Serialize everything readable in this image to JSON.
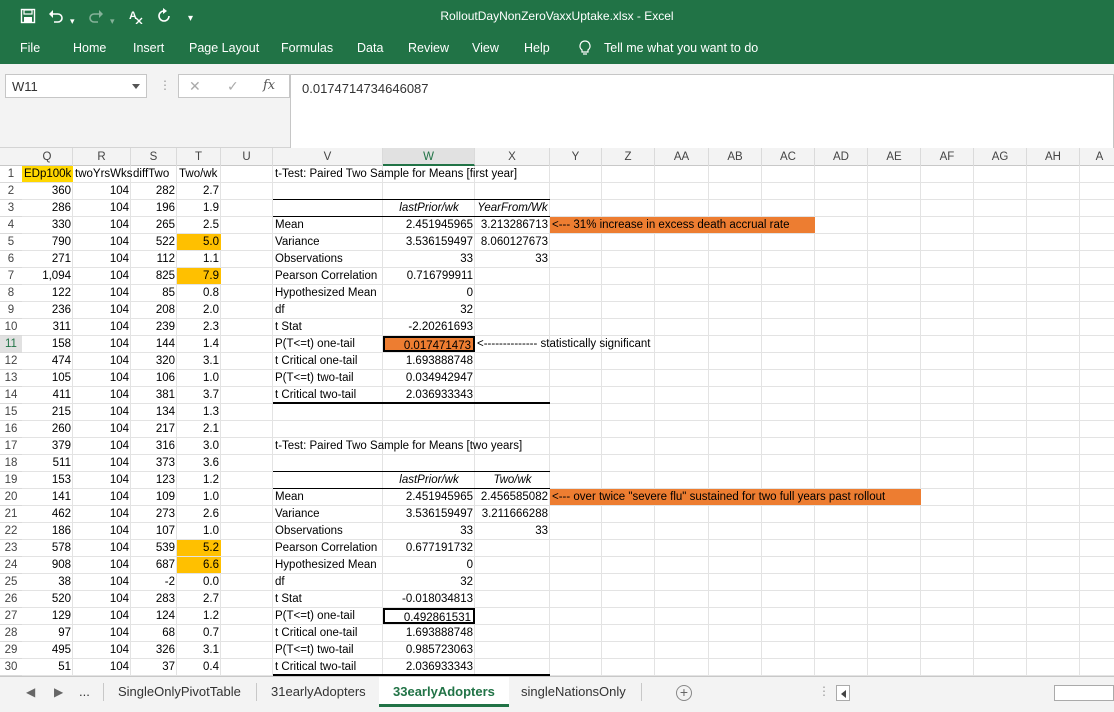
{
  "window": {
    "title": "RolloutDayNonZeroVaxxUptake.xlsx  -  Excel"
  },
  "ribbon": {
    "tabs": [
      "File",
      "Home",
      "Insert",
      "Page Layout",
      "Formulas",
      "Data",
      "Review",
      "View",
      "Help"
    ],
    "tell_me": "Tell me what you want to do"
  },
  "formula_bar": {
    "name_box": "W11",
    "cancel": "✕",
    "enter": "✓",
    "fx": "fx",
    "value": "0.0174714734646087"
  },
  "columns": [
    "Q",
    "R",
    "S",
    "T",
    "U",
    "V",
    "W",
    "X",
    "Y",
    "Z",
    "AA",
    "AB",
    "AC",
    "AD",
    "AE",
    "AF",
    "AG",
    "AH",
    "A"
  ],
  "rows": [
    "1",
    "2",
    "3",
    "4",
    "5",
    "6",
    "7",
    "8",
    "9",
    "10",
    "11",
    "12",
    "13",
    "14",
    "15",
    "16",
    "17",
    "18",
    "19",
    "20",
    "21",
    "22",
    "23",
    "24",
    "25",
    "26",
    "27",
    "28",
    "29",
    "30"
  ],
  "headers": {
    "q": "EDp100k",
    "r": "twoYrsWks",
    "s": "diffTwo",
    "t": "Two/wk"
  },
  "data_rows": [
    [
      "360",
      "104",
      "282",
      "2.7"
    ],
    [
      "286",
      "104",
      "196",
      "1.9"
    ],
    [
      "330",
      "104",
      "265",
      "2.5"
    ],
    [
      "790",
      "104",
      "522",
      "5.0"
    ],
    [
      "271",
      "104",
      "112",
      "1.1"
    ],
    [
      "1,094",
      "104",
      "825",
      "7.9"
    ],
    [
      "122",
      "104",
      "85",
      "0.8"
    ],
    [
      "236",
      "104",
      "208",
      "2.0"
    ],
    [
      "311",
      "104",
      "239",
      "2.3"
    ],
    [
      "158",
      "104",
      "144",
      "1.4"
    ],
    [
      "474",
      "104",
      "320",
      "3.1"
    ],
    [
      "105",
      "104",
      "106",
      "1.0"
    ],
    [
      "411",
      "104",
      "381",
      "3.7"
    ],
    [
      "215",
      "104",
      "134",
      "1.3"
    ],
    [
      "260",
      "104",
      "217",
      "2.1"
    ],
    [
      "379",
      "104",
      "316",
      "3.0"
    ],
    [
      "511",
      "104",
      "373",
      "3.6"
    ],
    [
      "153",
      "104",
      "123",
      "1.2"
    ],
    [
      "141",
      "104",
      "109",
      "1.0"
    ],
    [
      "462",
      "104",
      "273",
      "2.6"
    ],
    [
      "186",
      "104",
      "107",
      "1.0"
    ],
    [
      "578",
      "104",
      "539",
      "5.2"
    ],
    [
      "908",
      "104",
      "687",
      "6.6"
    ],
    [
      "38",
      "104",
      "-2",
      "0.0"
    ],
    [
      "520",
      "104",
      "283",
      "2.7"
    ],
    [
      "129",
      "104",
      "124",
      "1.2"
    ],
    [
      "97",
      "104",
      "68",
      "0.7"
    ],
    [
      "495",
      "104",
      "326",
      "3.1"
    ],
    [
      "51",
      "104",
      "37",
      "0.4"
    ]
  ],
  "ttest1": {
    "title": "t-Test: Paired Two Sample for Means [first year]",
    "col_a": "lastPrior/wk",
    "col_b": "YearFrom/Wk",
    "rows": [
      [
        "Mean",
        "2.451945965",
        "3.213286713"
      ],
      [
        "Variance",
        "3.536159497",
        "8.060127673"
      ],
      [
        "Observations",
        "33",
        "33"
      ],
      [
        "Pearson Correlation",
        "0.716799911",
        ""
      ],
      [
        "Hypothesized Mean",
        "0",
        ""
      ],
      [
        "df",
        "32",
        ""
      ],
      [
        "t Stat",
        "-2.20261693",
        ""
      ],
      [
        "P(T<=t) one-tail",
        "0.017471473",
        ""
      ],
      [
        "t Critical one-tail",
        "1.693888748",
        ""
      ],
      [
        "P(T<=t) two-tail",
        "0.034942947",
        ""
      ],
      [
        "t Critical two-tail",
        "2.036933343",
        ""
      ]
    ],
    "note_mean": "<--- 31% increase in excess death accrual rate",
    "note_p": "<-------------- statistically significant"
  },
  "ttest2": {
    "title": "t-Test: Paired Two Sample for Means [two years]",
    "col_a": "lastPrior/wk",
    "col_b": "Two/wk",
    "rows": [
      [
        "Mean",
        "2.451945965",
        "2.456585082"
      ],
      [
        "Variance",
        "3.536159497",
        "3.211666288"
      ],
      [
        "Observations",
        "33",
        "33"
      ],
      [
        "Pearson Correlation",
        "0.677191732",
        ""
      ],
      [
        "Hypothesized Mean",
        "0",
        ""
      ],
      [
        "df",
        "32",
        ""
      ],
      [
        "t Stat",
        "-0.018034813",
        ""
      ],
      [
        "P(T<=t) one-tail",
        "0.492861531",
        ""
      ],
      [
        "t Critical one-tail",
        "1.693888748",
        ""
      ],
      [
        "P(T<=t) two-tail",
        "0.985723063",
        ""
      ],
      [
        "t Critical two-tail",
        "2.036933343",
        ""
      ]
    ],
    "note_mean": "<--- over twice \"severe flu\" sustained for two full years past rollout"
  },
  "sheets": {
    "nav_more": "...",
    "tabs": [
      "SingleOnlyPivotTable",
      "31earlyAdopters",
      "33earlyAdopters",
      "singleNationsOnly"
    ],
    "add": "+"
  },
  "colors": {
    "excel_green": "#217346",
    "highlight_yellow": "#ffd700",
    "highlight_gold": "#ffc000",
    "highlight_orange": "#ed7d31"
  }
}
